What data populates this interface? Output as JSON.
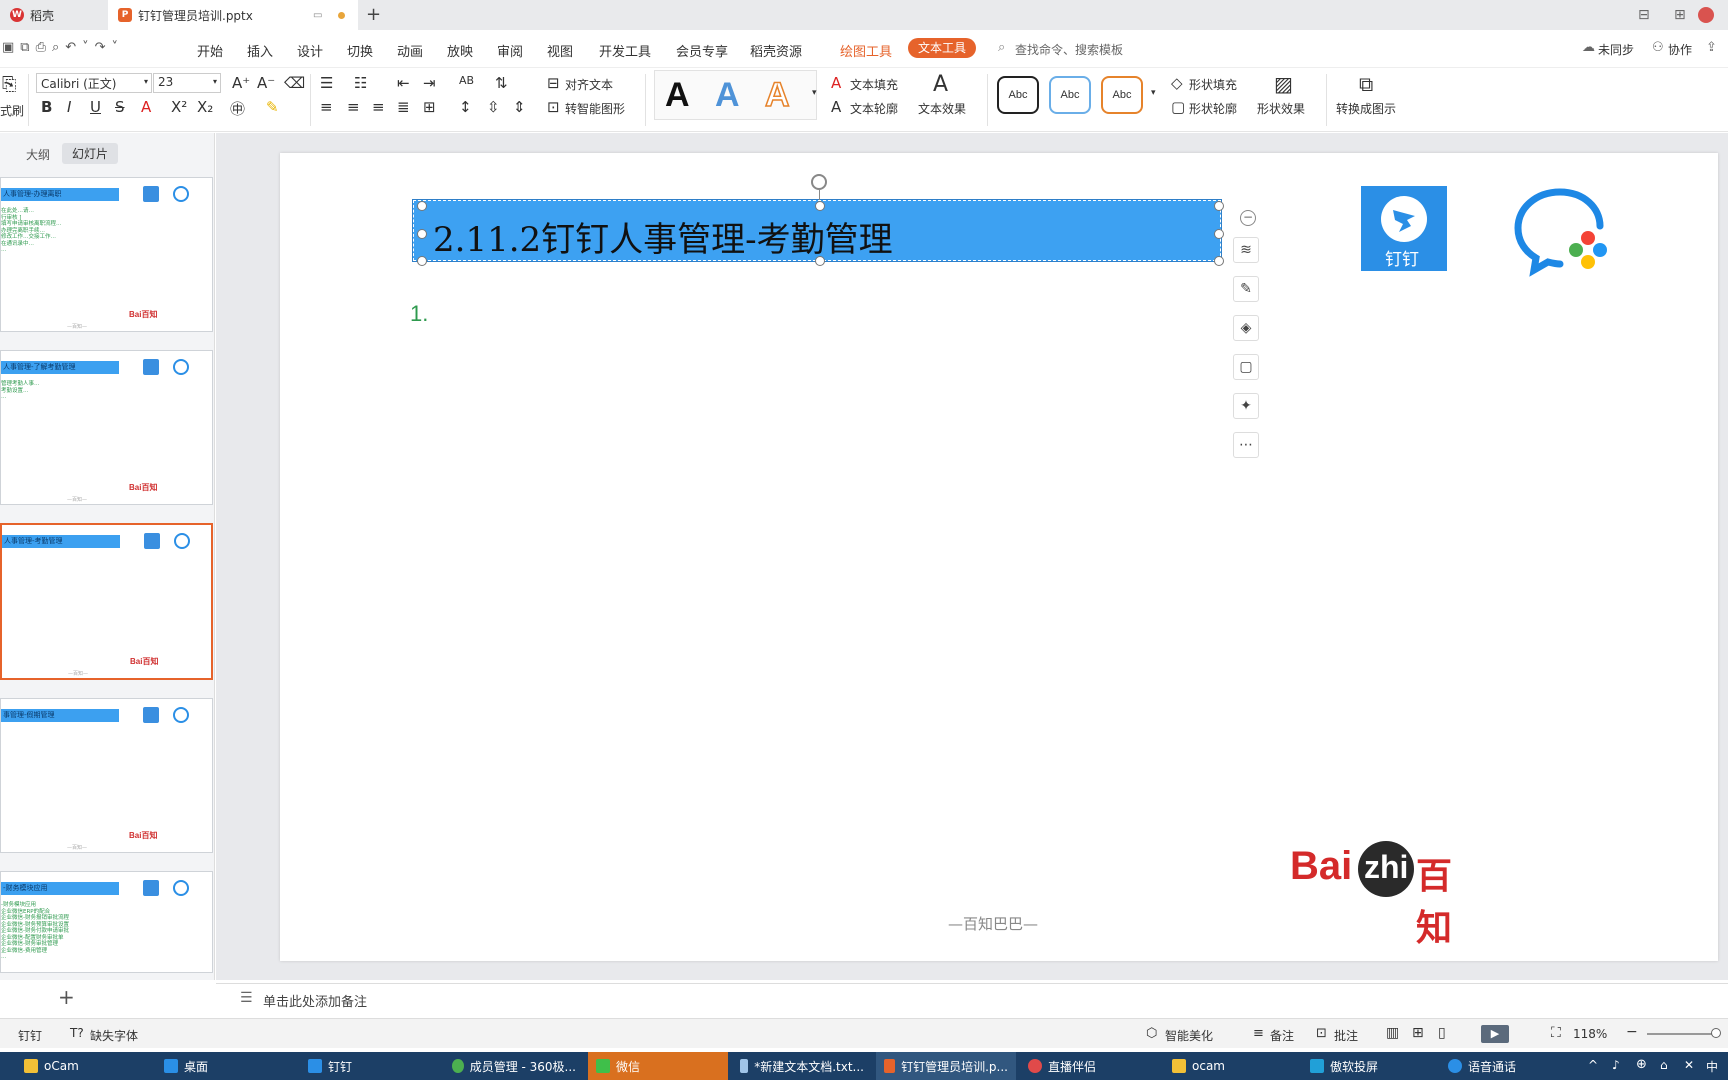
{
  "tabs": {
    "home_label": "稻壳",
    "file_label": "钉钉管理员培训.pptx",
    "new_tab": "+"
  },
  "menu": {
    "items": [
      "开始",
      "插入",
      "设计",
      "切换",
      "动画",
      "放映",
      "审阅",
      "视图",
      "开发工具",
      "会员专享",
      "稻壳资源"
    ],
    "draw_tools": "绘图工具",
    "text_tools": "文本工具",
    "search_placeholder": "查找命令、搜索模板",
    "sync": "未同步",
    "collab": "协作"
  },
  "ribbon": {
    "format_painter": "式刷",
    "font_name": "Calibri (正文)",
    "font_size": "23",
    "align_text": "对齐文本",
    "smart_shape": "转智能图形",
    "text_fill": "文本填充",
    "text_outline": "文本轮廓",
    "text_effect": "文本效果",
    "style_sample": "Abc",
    "shape_fill": "形状填充",
    "shape_outline": "形状轮廓",
    "shape_effect": "形状效果",
    "convert_graphic": "转换成图示",
    "big_a": "A"
  },
  "leftpanel": {
    "tab_outline": "大纲",
    "tab_slides": "幻灯片",
    "add": "+",
    "thumbnails": [
      {
        "title": "人事管理-办理离职",
        "body": "在此处…请…\n行审核 ]\n填写申请审核离职流程…\n办理完离职手续…\n修改工作…交接工作…\n在通讯录中…\n…"
      },
      {
        "title": "人事管理-了解考勤管理",
        "body": "管理考勤人事…\n考勤设置…\n…"
      },
      {
        "title": "人事管理-考勤管理",
        "body": ""
      },
      {
        "title": "事管理-假期管理",
        "body": ""
      },
      {
        "title": "-财务模块应用",
        "body": "-财务模块应用\n企业微信ERP的配合\n企业微信-财务报销审批流程\n企业微信-财务预算审批设置\n企业微信-财务付款申请审批\n企业微信-配置财务审批单\n企业微信-财务审批管理\n企业微信-费用管理\n…"
      }
    ],
    "thumb_brand": "Bai百知",
    "thumb_footer": "—百知—"
  },
  "slide": {
    "title": "2.11.2钉钉人事管理-考勤管理",
    "list_number": "1.",
    "dingtalk_label": "钉钉",
    "baizhi_en": "Bai",
    "baizhi_zhi": "zhi",
    "baizhi_cn": "百知",
    "footer": "—百知巴巴—"
  },
  "notes": {
    "placeholder": "单击此处添加备注"
  },
  "status": {
    "app": "钉钉",
    "missing_font": "缺失字体",
    "beautify": "智能美化",
    "remark": "备注",
    "comment": "批注",
    "zoom": "118%"
  },
  "taskbar": {
    "items": [
      "oCam",
      "桌面",
      "钉钉",
      "成员管理 - 360极...",
      "微信",
      "*新建文本文档.txt...",
      "钉钉管理员培训.p...",
      "直播伴侣",
      "ocam",
      "傲软投屏",
      "语音通话"
    ],
    "ime": "中"
  },
  "colors": {
    "accent": "#e6632b",
    "title_fill": "#3da1f2",
    "list_number": "#2e9a4e",
    "taskbar": "#1c3f66"
  }
}
